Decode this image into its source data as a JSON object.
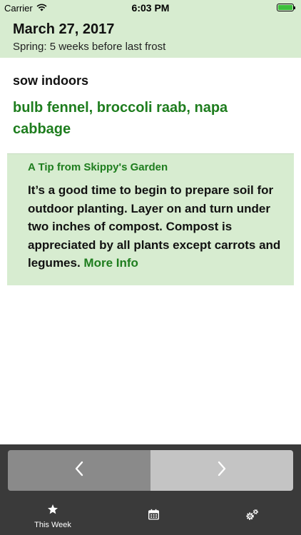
{
  "status_bar": {
    "carrier": "Carrier",
    "time": "6:03 PM",
    "battery_level": 1.0,
    "battery_color": "#3bbf3b"
  },
  "header": {
    "date": "March 27, 2017",
    "season": "Spring: 5 weeks before last frost"
  },
  "sow": {
    "heading": "sow indoors",
    "crops": "bulb fennel, broccoli raab, napa cabbage"
  },
  "tip": {
    "title": "A Tip from Skippy's Garden",
    "body": "It’s a good time to begin to prepare soil for outdoor planting. Layer on and turn under two inches of compost. Compost is appreciated by all plants except carrots and legumes.",
    "link": "More Info"
  },
  "nav": {
    "prev_icon": "chevron-left-icon",
    "next_icon": "chevron-right-icon"
  },
  "tabs": [
    {
      "label": "This Week",
      "icon": "star-icon"
    },
    {
      "label": "",
      "icon": "calendar-icon"
    },
    {
      "label": "",
      "icon": "gears-icon"
    }
  ],
  "colors": {
    "header_bg": "#d7ecd0",
    "accent_green": "#1e7d1e",
    "dark_bar": "#3a3a3a"
  }
}
